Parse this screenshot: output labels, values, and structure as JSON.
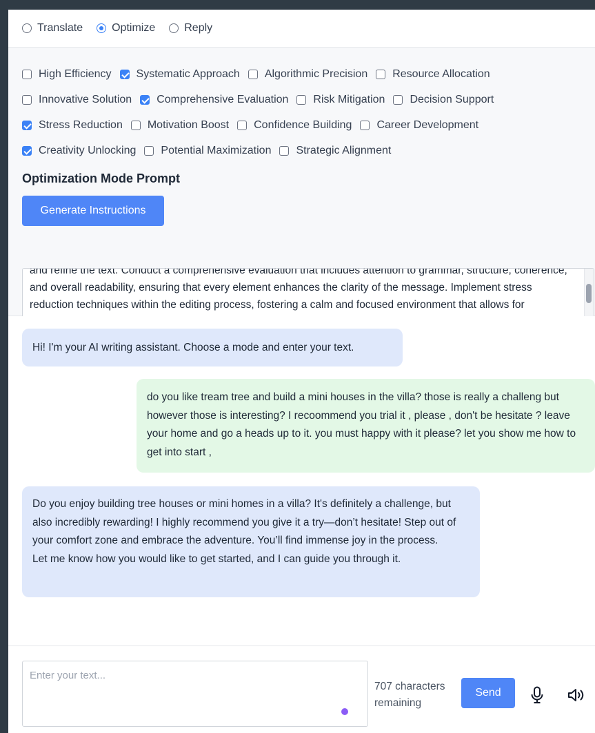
{
  "modes": [
    {
      "label": "Translate",
      "selected": false
    },
    {
      "label": "Optimize",
      "selected": true
    },
    {
      "label": "Reply",
      "selected": false
    }
  ],
  "options": {
    "rows": [
      [
        {
          "label": "High Efficiency",
          "checked": false
        },
        {
          "label": "Systematic Approach",
          "checked": true
        },
        {
          "label": "Algorithmic Precision",
          "checked": false
        },
        {
          "label": "Resource Allocation",
          "checked": false
        }
      ],
      [
        {
          "label": "Innovative Solution",
          "checked": false
        },
        {
          "label": "Comprehensive Evaluation",
          "checked": true
        },
        {
          "label": "Risk Mitigation",
          "checked": false
        },
        {
          "label": "Decision Support",
          "checked": false
        }
      ],
      [
        {
          "label": "Stress Reduction",
          "checked": true
        },
        {
          "label": "Motivation Boost",
          "checked": false
        },
        {
          "label": "Confidence Building",
          "checked": false
        },
        {
          "label": "Career Development",
          "checked": false
        }
      ],
      [
        {
          "label": "Creativity Unlocking",
          "checked": true
        },
        {
          "label": "Potential Maximization",
          "checked": false
        },
        {
          "label": "Strategic Alignment",
          "checked": false
        }
      ]
    ]
  },
  "prompt": {
    "title": "Optimization Mode Prompt",
    "generate_label": "Generate Instructions",
    "text": "and refine the text. Conduct a comprehensive evaluation that includes attention to grammar, structure, coherence, and overall readability, ensuring that every element enhances the clarity of the message. Implement stress reduction techniques within the editing process, fostering a calm and focused environment that allows for meticulous attention to detail. Additionally, encourage creativity unlocking by suggesting fresh perspectives and innovative phrasing that maximize potential."
  },
  "chat": {
    "messages": [
      {
        "role": "ai",
        "text": "Hi! I'm your AI writing assistant. Choose a mode and enter your text."
      },
      {
        "role": "user",
        "text": "do you like tream tree and build a mini houses in the villa? those is really a challeng but however those is interesting? I recoommend you trial it , please , don't be hesitate ? leave your home and go a heads up to it. you must happy with it please? let you show me how to get into start ,"
      },
      {
        "role": "ai",
        "text": "Do you enjoy building tree houses or mini homes in a villa? It's definitely a challenge, but also incredibly rewarding! I highly recommend you give it a try—don’t hesitate! Step out of your comfort zone and embrace the adventure. You’ll find immense joy in the process.\nLet me know how you would like to get started, and I can guide you through it."
      }
    ]
  },
  "composer": {
    "placeholder": "Enter your text...",
    "char_count": "707 characters remaining",
    "send_label": "Send",
    "mic_icon": "microphone-icon",
    "speaker_icon": "speaker-icon"
  },
  "colors": {
    "accent": "#4f86f7",
    "ai_bubble": "#dfe8fb",
    "user_bubble": "#e3f8e6",
    "grammar_dot": "#8b5cf6"
  }
}
